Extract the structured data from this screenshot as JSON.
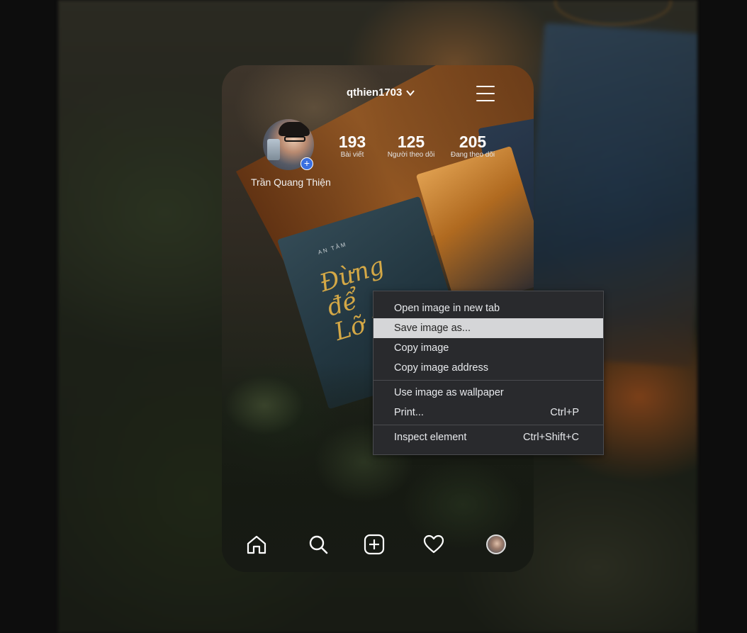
{
  "profile": {
    "username": "qthien1703",
    "display_name": "Trần Quang Thiện",
    "stats": [
      {
        "value": "193",
        "label": "Bài viết"
      },
      {
        "value": "125",
        "label": "Người theo dõi"
      },
      {
        "value": "205",
        "label": "Đang theo dõi"
      }
    ],
    "add_story_glyph": "+"
  },
  "book": {
    "small_text": "AN TÂM",
    "title_line1": "Đừng",
    "title_line2": "để",
    "title_line3": "Lỡ nhau"
  },
  "nav": {
    "icons": [
      "home-icon",
      "search-icon",
      "add-post-icon",
      "heart-icon",
      "profile-avatar"
    ]
  },
  "context_menu": {
    "items": [
      {
        "label": "Open image in new tab",
        "shortcut": ""
      },
      {
        "label": "Save image as...",
        "shortcut": "",
        "highlighted": true
      },
      {
        "label": "Copy image",
        "shortcut": ""
      },
      {
        "label": "Copy image address",
        "shortcut": ""
      },
      {
        "label": "Use image as wallpaper",
        "shortcut": ""
      },
      {
        "label": "Print...",
        "shortcut": "Ctrl+P"
      },
      {
        "label": "Inspect element",
        "shortcut": "Ctrl+Shift+C"
      }
    ],
    "colors": {
      "background": "#292a2d",
      "highlight": "#d5d6d8",
      "text": "#e8eaed"
    }
  },
  "colors": {
    "accent_blue": "#3a6fe0",
    "page_bg": "#0d0d0d"
  }
}
